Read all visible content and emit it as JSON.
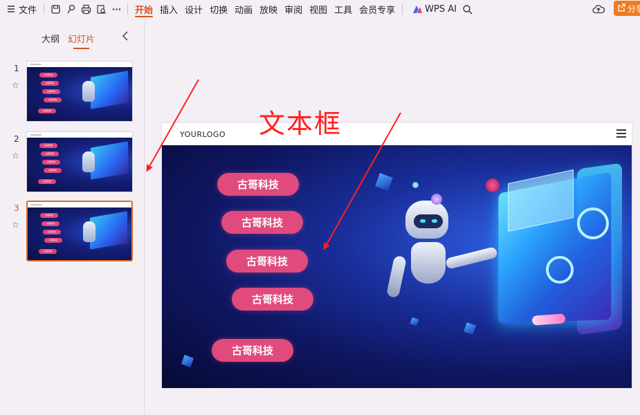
{
  "toolbar": {
    "menu_label": "文件",
    "tabs": [
      "开始",
      "插入",
      "设计",
      "切换",
      "动画",
      "放映",
      "审阅",
      "视图",
      "工具",
      "会员专享"
    ],
    "active_tab": "开始",
    "ai_label": "WPS AI",
    "share_label": "分享"
  },
  "left_panel": {
    "tab_outline": "大纲",
    "tab_slides": "幻灯片",
    "slides": [
      {
        "num": "1",
        "header": "YOURLOGO",
        "pill": "古哥科技"
      },
      {
        "num": "2",
        "header": "YOURLOGO",
        "pill": "古哥科技"
      },
      {
        "num": "3",
        "header": "YOURLOGO",
        "pill": "古哥科技"
      }
    ]
  },
  "slide": {
    "logo": "YOURLOGO",
    "pills": [
      "古哥科技",
      "古哥科技",
      "古哥科技",
      "古哥科技",
      "古哥科技"
    ]
  },
  "annotation": {
    "text": "文本框",
    "color": "#ff1f1f"
  },
  "colors": {
    "accent": "#d4561a",
    "pill": "#e14a7d",
    "share": "#f07b1f"
  }
}
